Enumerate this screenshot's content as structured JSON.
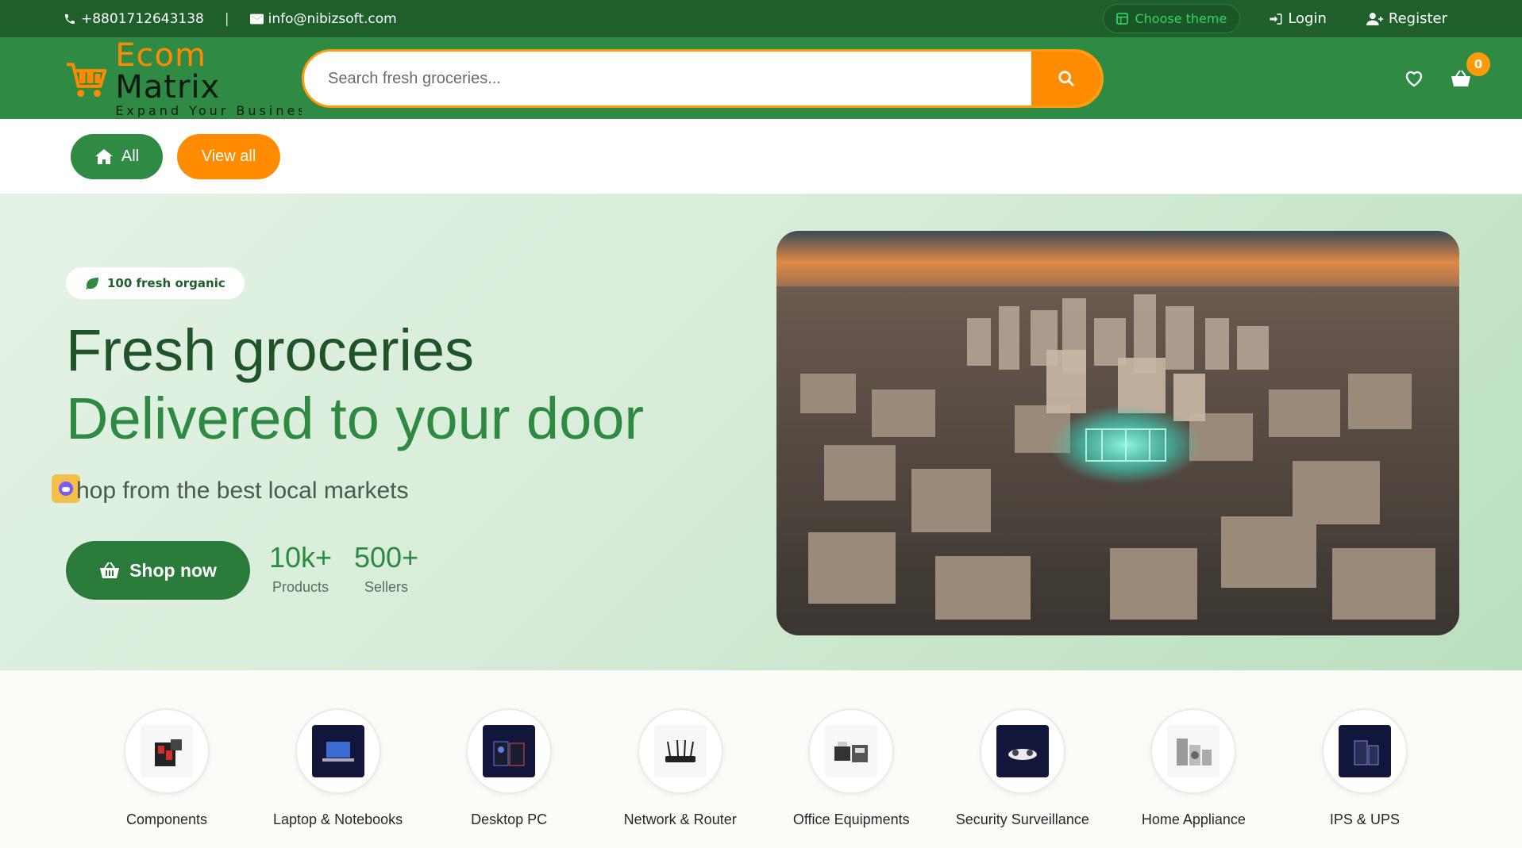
{
  "topbar": {
    "phone": "+8801712643138",
    "separator": "|",
    "email": "info@nibizsoft.com",
    "theme_button": "Choose theme",
    "login": "Login",
    "register": "Register"
  },
  "header": {
    "logo_ecom": "Ecom",
    "logo_matrix": "Matrix",
    "logo_tagline": "Expand Your Business",
    "search_placeholder": "Search fresh groceries...",
    "cart_count": "0"
  },
  "pills": {
    "all": "All",
    "view_all": "View all"
  },
  "hero": {
    "badge": "100 fresh organic",
    "title_line1": "Fresh groceries",
    "title_line2": "Delivered to your door",
    "subtitle": "hop from the best local markets",
    "shop_button": "Shop now",
    "stats": [
      {
        "value": "10k+",
        "label": "Products"
      },
      {
        "value": "500+",
        "label": "Sellers"
      }
    ]
  },
  "categories": [
    {
      "label": "Components"
    },
    {
      "label": "Laptop & Notebooks"
    },
    {
      "label": "Desktop PC"
    },
    {
      "label": "Network & Router"
    },
    {
      "label": "Office Equipments"
    },
    {
      "label": "Security Surveillance"
    },
    {
      "label": "Home Appliance"
    },
    {
      "label": "IPS & UPS"
    }
  ],
  "colors": {
    "topbar": "#1f5f2b",
    "header": "#2f8a44",
    "accent": "#ff8c00",
    "hero_text": "#1e5427"
  }
}
